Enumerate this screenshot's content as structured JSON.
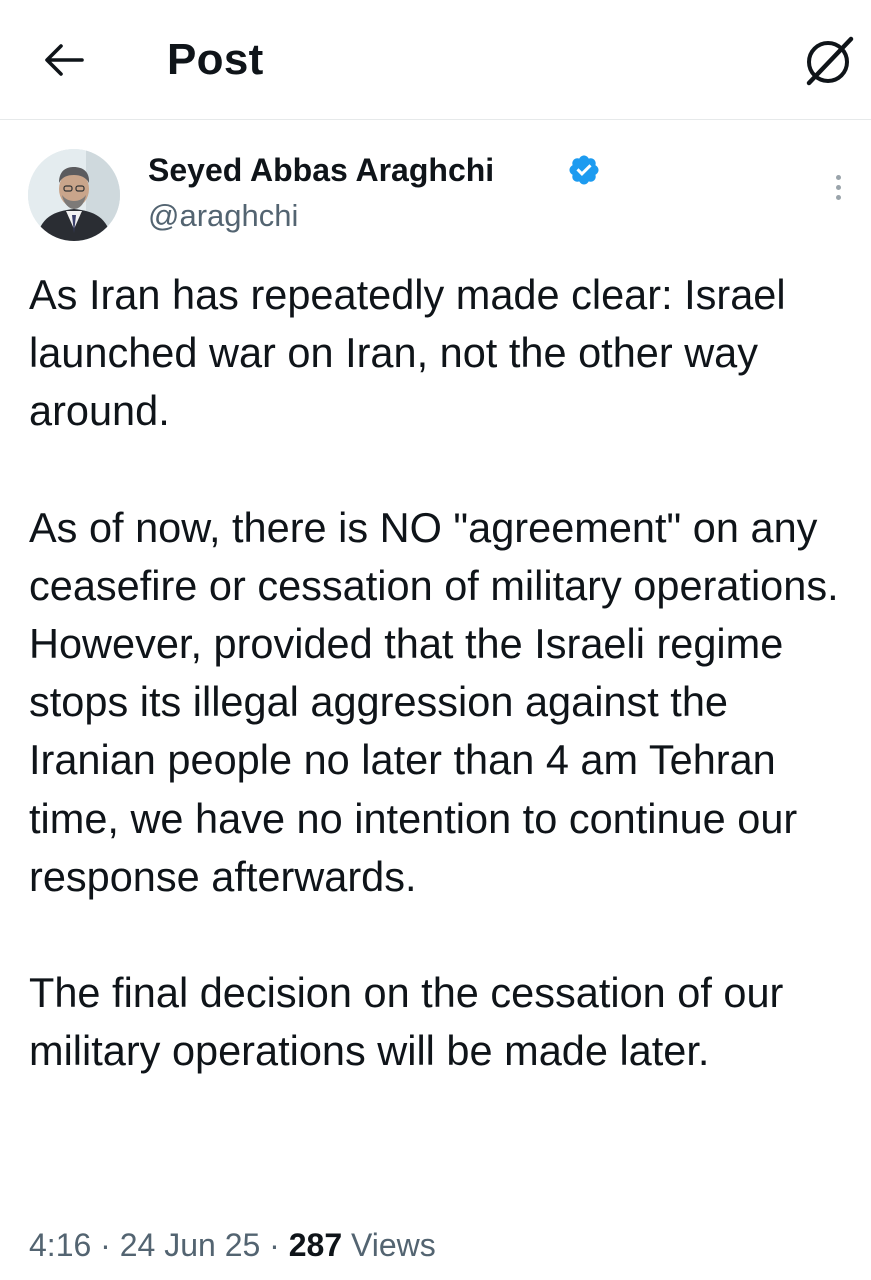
{
  "header": {
    "title": "Post",
    "back_icon": "arrow-left-icon",
    "grok_icon": "grok-slash-icon"
  },
  "post": {
    "author": {
      "name": "Seyed Abbas Araghchi",
      "handle": "@araghchi",
      "verified": true,
      "verified_color": "#1d9bf0"
    },
    "paragraphs": [
      "As Iran has repeatedly made clear: Israel launched war on Iran, not the other way around.",
      "As of now, there is NO \"agreement\" on any ceasefire or cessation of military operations. However, provided that the Israeli regime stops its illegal aggression against the Iranian people no later than 4 am Tehran time, we have no intention to continue our response afterwards.",
      "The final decision on the cessation of our military operations will be made later."
    ],
    "time": "4:16",
    "separator": "·",
    "date": "24 Jun 25",
    "views_count": "287",
    "views_label": "Views"
  },
  "colors": {
    "text": "#0f1419",
    "secondary": "#536471",
    "divider": "#e6e9ea"
  }
}
